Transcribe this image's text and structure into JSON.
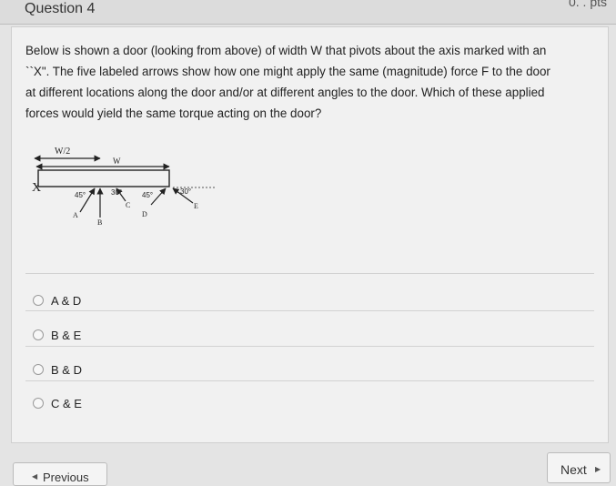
{
  "header": {
    "title": "Question 4",
    "points": "0. . pts"
  },
  "question": {
    "lines": [
      "Below is shown a door (looking from above) of width W that pivots about the axis marked with an",
      "``X\". The five labeled arrows show how one might apply the same (magnitude) force F to the door",
      "at different locations along the door and/or at different angles to the door. Which of these applied",
      "forces would yield the same torque acting on the door?"
    ]
  },
  "figure": {
    "half_width_label": "W/2",
    "width_label": "W",
    "pivot_label": "X",
    "angle_labels": [
      "45°",
      "30°",
      "45°",
      "30°"
    ],
    "arrow_labels": [
      "A",
      "B",
      "C",
      "D",
      "E"
    ]
  },
  "options": [
    {
      "label": "A & D"
    },
    {
      "label": "B & E"
    },
    {
      "label": "B & D"
    },
    {
      "label": "C & E"
    }
  ],
  "nav": {
    "previous_label": "Previous",
    "next_label": "Next"
  }
}
